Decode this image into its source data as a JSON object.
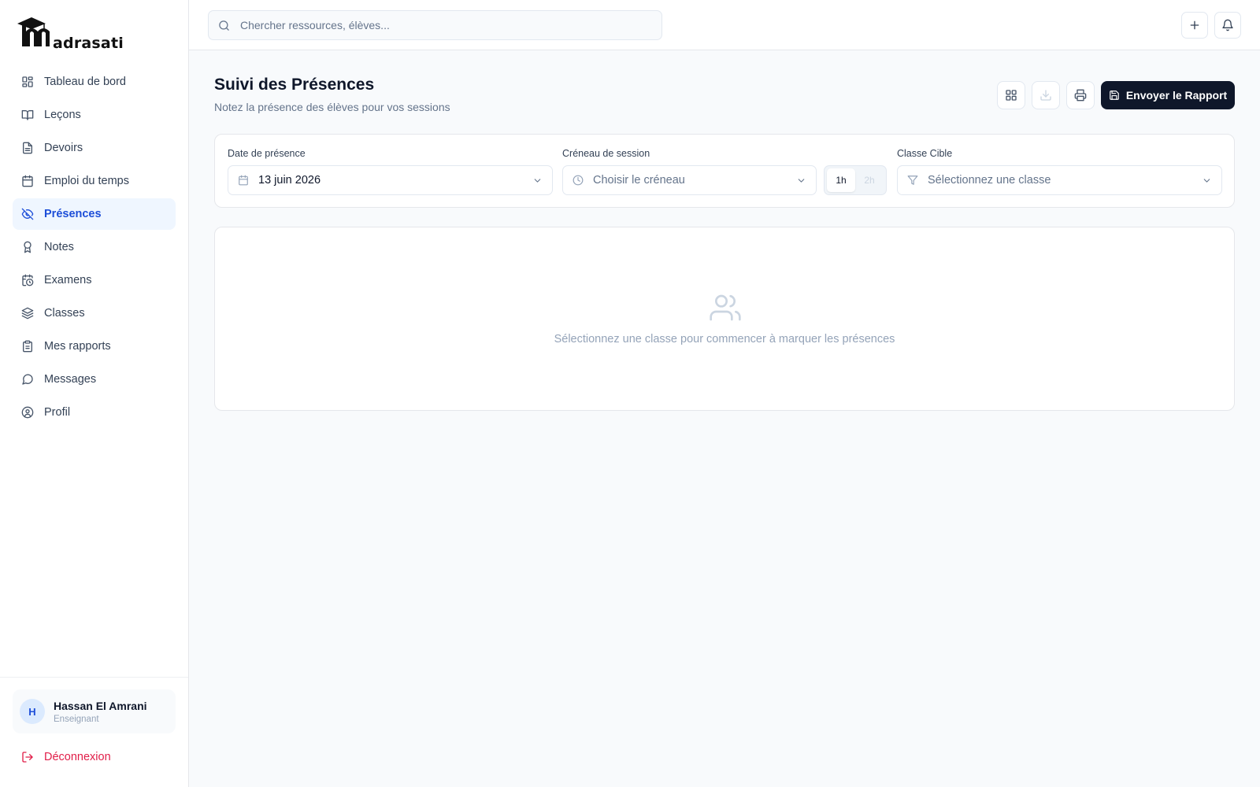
{
  "brand": {
    "name": "adrasati",
    "logo_letter": "m"
  },
  "sidebar": {
    "items": [
      {
        "label": "Tableau de bord",
        "icon": "dashboard-icon",
        "active": false
      },
      {
        "label": "Leçons",
        "icon": "book-icon",
        "active": false
      },
      {
        "label": "Devoirs",
        "icon": "file-text-icon",
        "active": false
      },
      {
        "label": "Emploi du temps",
        "icon": "calendar-icon",
        "active": false
      },
      {
        "label": "Présences",
        "icon": "eye-off-icon",
        "active": true
      },
      {
        "label": "Notes",
        "icon": "award-icon",
        "active": false
      },
      {
        "label": "Examens",
        "icon": "calendar-clock-icon",
        "active": false
      },
      {
        "label": "Classes",
        "icon": "layers-icon",
        "active": false
      },
      {
        "label": "Mes rapports",
        "icon": "clipboard-icon",
        "active": false
      },
      {
        "label": "Messages",
        "icon": "message-circle-icon",
        "active": false
      },
      {
        "label": "Profil",
        "icon": "user-circle-icon",
        "active": false
      }
    ],
    "user": {
      "initial": "H",
      "name": "Hassan El Amrani",
      "role": "Enseignant"
    },
    "logout_label": "Déconnexion"
  },
  "topbar": {
    "search_placeholder": "Chercher ressources, élèves...",
    "add_icon": "plus-icon",
    "notification_icon": "bell-icon"
  },
  "main": {
    "title": "Suivi des Présences",
    "subtitle": "Notez la présence des élèves pour vos sessions",
    "send_report_label": "Envoyer le Rapport",
    "toolbar_icons": [
      "grid-icon",
      "download-icon",
      "printer-icon",
      "save-icon"
    ]
  },
  "filters": {
    "date": {
      "label": "Date de présence",
      "value": "13 juin 2026"
    },
    "slot": {
      "label": "Créneau de session",
      "placeholder": "Choisir le créneau"
    },
    "duration": {
      "options": [
        "1h",
        "2h"
      ],
      "selected": "1h"
    },
    "class": {
      "label": "Classe Cible",
      "placeholder": "Sélectionnez une classe"
    }
  },
  "empty_state": {
    "icon": "users-icon",
    "message": "Sélectionnez une classe pour commencer à marquer les présences"
  },
  "colors": {
    "accent": "#1d4ed8",
    "accent_bg": "#eff6ff",
    "primary_button": "#0f172a",
    "danger": "#e11d48",
    "background": "#f8fafc"
  }
}
